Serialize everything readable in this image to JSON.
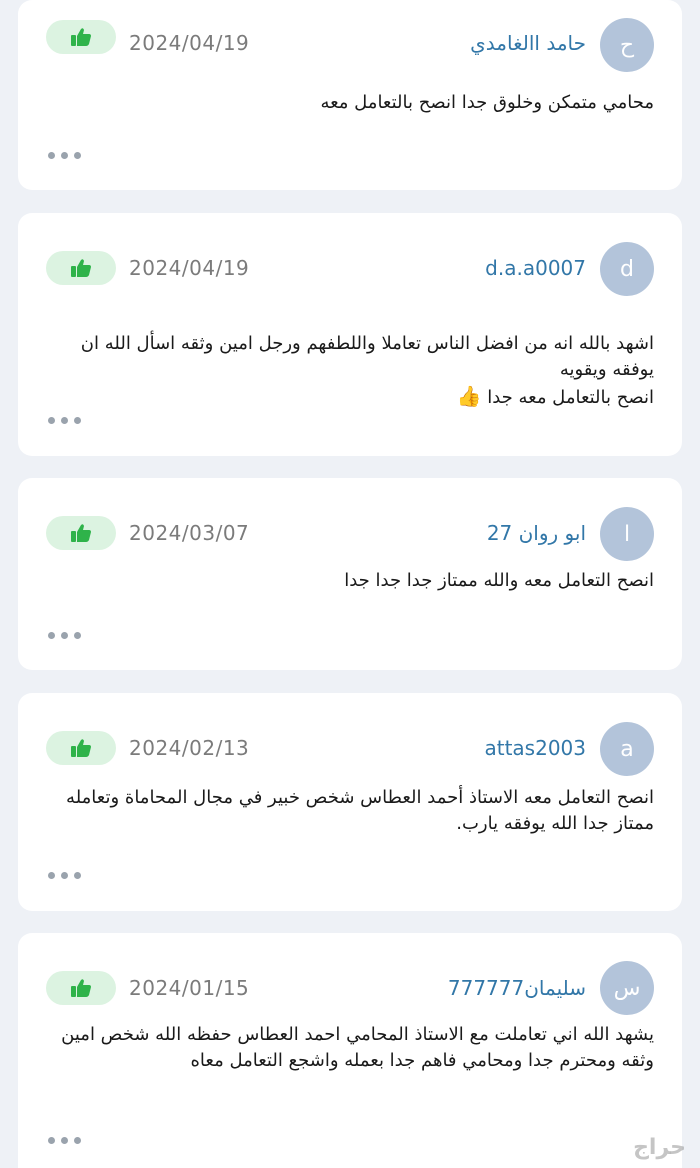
{
  "colors": {
    "background": "#eef1f6",
    "card": "#ffffff",
    "avatar": "#b3c4da",
    "username": "#3277a8",
    "like_bg": "#dcf3e1",
    "like_icon": "#2fb34a"
  },
  "reviews": [
    {
      "avatar_letter": "ح",
      "username": "حامد االغامدي",
      "date": "2024/04/19",
      "text": "محامي متمكن وخلوق جدا   انصح بالتعامل معه"
    },
    {
      "avatar_letter": "d",
      "username": "d.a.a0007",
      "date": "2024/04/19",
      "text": "اشهد بالله انه من افضل الناس تعاملا  واللطفهم ورجل امين وثقه اسأل الله ان يوفقه ويقويه\nانصح بالتعامل معه جدا ",
      "emoji": "👍"
    },
    {
      "avatar_letter": "ا",
      "username": "ابو روان 27",
      "date": "2024/03/07",
      "text": "انصح التعامل معه والله ممتاز جدا جدا جدا"
    },
    {
      "avatar_letter": "a",
      "username": "attas2003",
      "date": "2024/02/13",
      "text": "انصح التعامل معه الاستاذ أحمد العطاس شخص خبير في مجال المحاماة وتعامله ممتاز جدا  الله يوفقه يارب."
    },
    {
      "avatar_letter": "س",
      "username": "سليمان777777",
      "date": "2024/01/15",
      "text": "يشهد الله اني تعاملت مع الاستاذ المحامي احمد العطاس حفظه الله شخص امين وثقه ومحترم جدا ومحامي فاهم جدا بعمله واشجع التعامل معاه"
    }
  ],
  "watermark": "حراج"
}
